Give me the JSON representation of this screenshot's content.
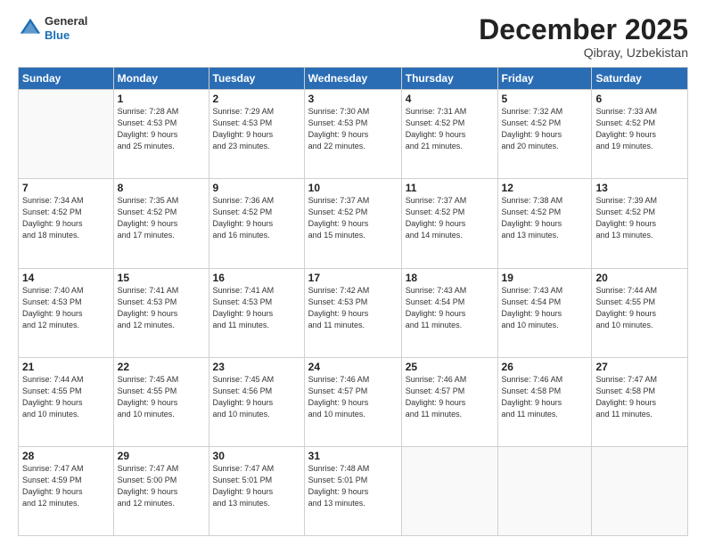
{
  "logo": {
    "general": "General",
    "blue": "Blue"
  },
  "title": {
    "month": "December 2025",
    "location": "Qibray, Uzbekistan"
  },
  "header_days": [
    "Sunday",
    "Monday",
    "Tuesday",
    "Wednesday",
    "Thursday",
    "Friday",
    "Saturday"
  ],
  "weeks": [
    [
      {
        "day": "",
        "info": ""
      },
      {
        "day": "1",
        "info": "Sunrise: 7:28 AM\nSunset: 4:53 PM\nDaylight: 9 hours\nand 25 minutes."
      },
      {
        "day": "2",
        "info": "Sunrise: 7:29 AM\nSunset: 4:53 PM\nDaylight: 9 hours\nand 23 minutes."
      },
      {
        "day": "3",
        "info": "Sunrise: 7:30 AM\nSunset: 4:53 PM\nDaylight: 9 hours\nand 22 minutes."
      },
      {
        "day": "4",
        "info": "Sunrise: 7:31 AM\nSunset: 4:52 PM\nDaylight: 9 hours\nand 21 minutes."
      },
      {
        "day": "5",
        "info": "Sunrise: 7:32 AM\nSunset: 4:52 PM\nDaylight: 9 hours\nand 20 minutes."
      },
      {
        "day": "6",
        "info": "Sunrise: 7:33 AM\nSunset: 4:52 PM\nDaylight: 9 hours\nand 19 minutes."
      }
    ],
    [
      {
        "day": "7",
        "info": "Sunrise: 7:34 AM\nSunset: 4:52 PM\nDaylight: 9 hours\nand 18 minutes."
      },
      {
        "day": "8",
        "info": "Sunrise: 7:35 AM\nSunset: 4:52 PM\nDaylight: 9 hours\nand 17 minutes."
      },
      {
        "day": "9",
        "info": "Sunrise: 7:36 AM\nSunset: 4:52 PM\nDaylight: 9 hours\nand 16 minutes."
      },
      {
        "day": "10",
        "info": "Sunrise: 7:37 AM\nSunset: 4:52 PM\nDaylight: 9 hours\nand 15 minutes."
      },
      {
        "day": "11",
        "info": "Sunrise: 7:37 AM\nSunset: 4:52 PM\nDaylight: 9 hours\nand 14 minutes."
      },
      {
        "day": "12",
        "info": "Sunrise: 7:38 AM\nSunset: 4:52 PM\nDaylight: 9 hours\nand 13 minutes."
      },
      {
        "day": "13",
        "info": "Sunrise: 7:39 AM\nSunset: 4:52 PM\nDaylight: 9 hours\nand 13 minutes."
      }
    ],
    [
      {
        "day": "14",
        "info": "Sunrise: 7:40 AM\nSunset: 4:53 PM\nDaylight: 9 hours\nand 12 minutes."
      },
      {
        "day": "15",
        "info": "Sunrise: 7:41 AM\nSunset: 4:53 PM\nDaylight: 9 hours\nand 12 minutes."
      },
      {
        "day": "16",
        "info": "Sunrise: 7:41 AM\nSunset: 4:53 PM\nDaylight: 9 hours\nand 11 minutes."
      },
      {
        "day": "17",
        "info": "Sunrise: 7:42 AM\nSunset: 4:53 PM\nDaylight: 9 hours\nand 11 minutes."
      },
      {
        "day": "18",
        "info": "Sunrise: 7:43 AM\nSunset: 4:54 PM\nDaylight: 9 hours\nand 11 minutes."
      },
      {
        "day": "19",
        "info": "Sunrise: 7:43 AM\nSunset: 4:54 PM\nDaylight: 9 hours\nand 10 minutes."
      },
      {
        "day": "20",
        "info": "Sunrise: 7:44 AM\nSunset: 4:55 PM\nDaylight: 9 hours\nand 10 minutes."
      }
    ],
    [
      {
        "day": "21",
        "info": "Sunrise: 7:44 AM\nSunset: 4:55 PM\nDaylight: 9 hours\nand 10 minutes."
      },
      {
        "day": "22",
        "info": "Sunrise: 7:45 AM\nSunset: 4:55 PM\nDaylight: 9 hours\nand 10 minutes."
      },
      {
        "day": "23",
        "info": "Sunrise: 7:45 AM\nSunset: 4:56 PM\nDaylight: 9 hours\nand 10 minutes."
      },
      {
        "day": "24",
        "info": "Sunrise: 7:46 AM\nSunset: 4:57 PM\nDaylight: 9 hours\nand 10 minutes."
      },
      {
        "day": "25",
        "info": "Sunrise: 7:46 AM\nSunset: 4:57 PM\nDaylight: 9 hours\nand 11 minutes."
      },
      {
        "day": "26",
        "info": "Sunrise: 7:46 AM\nSunset: 4:58 PM\nDaylight: 9 hours\nand 11 minutes."
      },
      {
        "day": "27",
        "info": "Sunrise: 7:47 AM\nSunset: 4:58 PM\nDaylight: 9 hours\nand 11 minutes."
      }
    ],
    [
      {
        "day": "28",
        "info": "Sunrise: 7:47 AM\nSunset: 4:59 PM\nDaylight: 9 hours\nand 12 minutes."
      },
      {
        "day": "29",
        "info": "Sunrise: 7:47 AM\nSunset: 5:00 PM\nDaylight: 9 hours\nand 12 minutes."
      },
      {
        "day": "30",
        "info": "Sunrise: 7:47 AM\nSunset: 5:01 PM\nDaylight: 9 hours\nand 13 minutes."
      },
      {
        "day": "31",
        "info": "Sunrise: 7:48 AM\nSunset: 5:01 PM\nDaylight: 9 hours\nand 13 minutes."
      },
      {
        "day": "",
        "info": ""
      },
      {
        "day": "",
        "info": ""
      },
      {
        "day": "",
        "info": ""
      }
    ]
  ]
}
